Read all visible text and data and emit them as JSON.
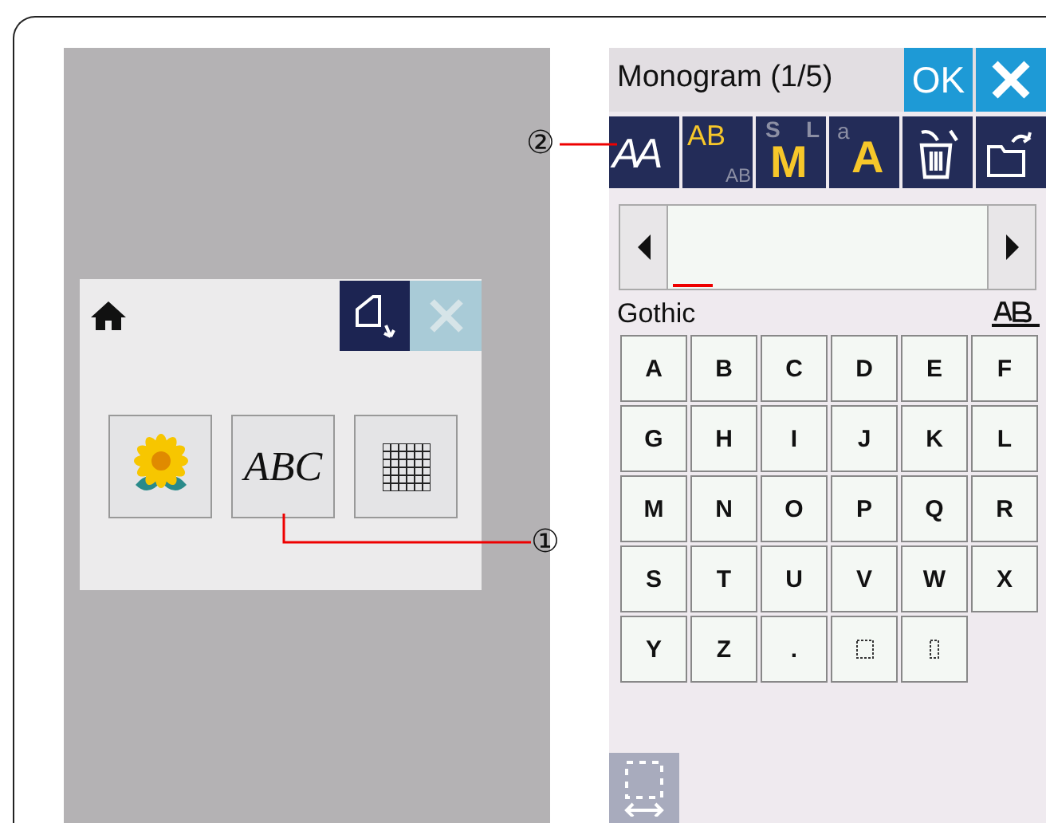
{
  "left_screen": {
    "close_button": {
      "disabled": true
    },
    "buttons": [
      {
        "kind": "flower"
      },
      {
        "kind": "text",
        "label": "ABC"
      },
      {
        "kind": "grid"
      }
    ]
  },
  "callouts": [
    {
      "label": "②"
    },
    {
      "label": "①"
    }
  ],
  "right_screen": {
    "title": "Monogram (1/5)",
    "ok_button": "OK",
    "toolbar": [
      {
        "kind": "font",
        "main": "AA"
      },
      {
        "kind": "case",
        "main": "AB",
        "alt": "AB"
      },
      {
        "kind": "size",
        "main": "M",
        "alt": "S",
        "alt2": "L"
      },
      {
        "kind": "lower",
        "main": "A",
        "alt": "a"
      },
      {
        "kind": "delete"
      },
      {
        "kind": "open"
      }
    ],
    "font_name": "Gothic",
    "keys": [
      {
        "kind": "char",
        "label": "A"
      },
      {
        "kind": "char",
        "label": "B"
      },
      {
        "kind": "char",
        "label": "C"
      },
      {
        "kind": "char",
        "label": "D"
      },
      {
        "kind": "char",
        "label": "E"
      },
      {
        "kind": "char",
        "label": "F"
      },
      {
        "kind": "char",
        "label": "G"
      },
      {
        "kind": "char",
        "label": "H"
      },
      {
        "kind": "char",
        "label": "I"
      },
      {
        "kind": "char",
        "label": "J"
      },
      {
        "kind": "char",
        "label": "K"
      },
      {
        "kind": "char",
        "label": "L"
      },
      {
        "kind": "char",
        "label": "M"
      },
      {
        "kind": "char",
        "label": "N"
      },
      {
        "kind": "char",
        "label": "O"
      },
      {
        "kind": "char",
        "label": "P"
      },
      {
        "kind": "char",
        "label": "Q"
      },
      {
        "kind": "char",
        "label": "R"
      },
      {
        "kind": "char",
        "label": "S"
      },
      {
        "kind": "char",
        "label": "T"
      },
      {
        "kind": "char",
        "label": "U"
      },
      {
        "kind": "char",
        "label": "V"
      },
      {
        "kind": "char",
        "label": "W"
      },
      {
        "kind": "char",
        "label": "X"
      },
      {
        "kind": "char",
        "label": "Y"
      },
      {
        "kind": "char",
        "label": "Z"
      },
      {
        "kind": "char",
        "label": "."
      },
      {
        "kind": "space"
      },
      {
        "kind": "narrow-space"
      }
    ]
  }
}
